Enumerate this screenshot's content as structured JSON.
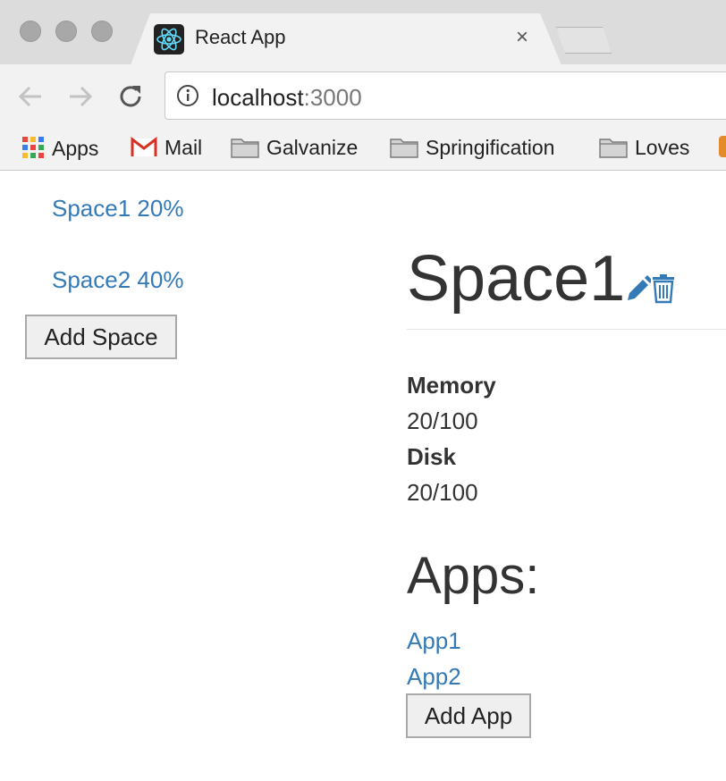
{
  "browser": {
    "tab_title": "React App",
    "tab_close": "×",
    "url_host": "localhost",
    "url_port": ":3000",
    "bookmarks": [
      "Apps",
      "Mail",
      "Galvanize",
      "Springification",
      "Loves"
    ]
  },
  "sidebar": {
    "spaces": [
      {
        "label": "Space1 20%"
      },
      {
        "label": "Space2 40%"
      }
    ],
    "add_space_label": "Add Space"
  },
  "detail": {
    "title": "Space1",
    "memory_label": "Memory",
    "memory_value": "20/100",
    "disk_label": "Disk",
    "disk_value": "20/100",
    "apps_heading": "Apps:",
    "apps": [
      "App1",
      "App2"
    ],
    "add_app_label": "Add App"
  },
  "colors": {
    "link": "#337ab7",
    "text": "#333333",
    "chrome": "#f2f2f2"
  },
  "icons": [
    "react-icon",
    "close-icon",
    "back-icon",
    "forward-icon",
    "reload-icon",
    "info-icon",
    "apps-grid-icon",
    "gmail-icon",
    "folder-icon",
    "pencil-icon",
    "trash-icon"
  ]
}
